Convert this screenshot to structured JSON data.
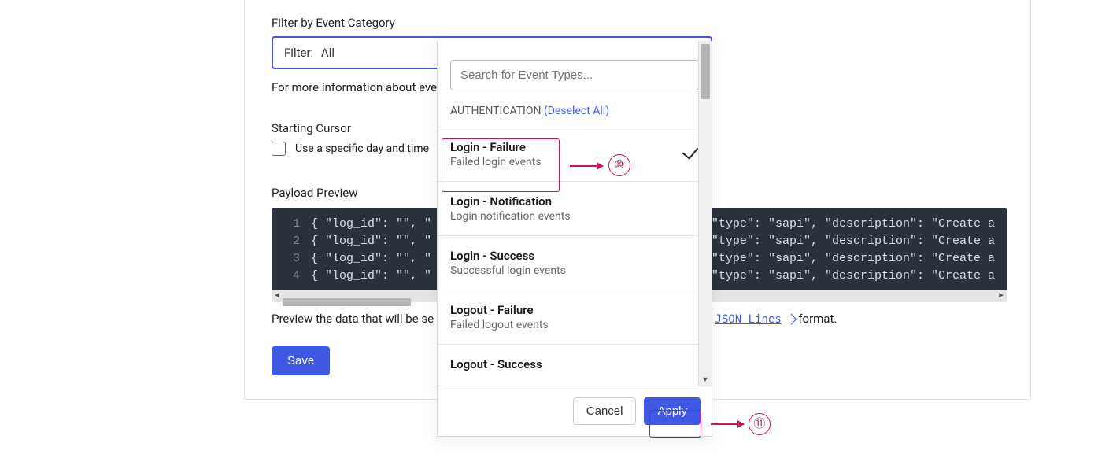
{
  "filter": {
    "label": "Filter by Event Category",
    "prompt": "Filter:",
    "value": "All",
    "hint_before_cut": "For more information about eve"
  },
  "cursor": {
    "label": "Starting Cursor",
    "checkbox_label_before_cut": "Use a specific day and time"
  },
  "payload": {
    "label": "Payload Preview",
    "lines": [
      "{ \"log_id\": \"\", \"",
      "{ \"log_id\": \"\", \"",
      "{ \"log_id\": \"\", \"",
      "{ \"log_id\": \"\", \""
    ],
    "line_tails": [
      "\", \"type\": \"sapi\", \"description\": \"Create a ",
      "\", \"type\": \"sapi\", \"description\": \"Create a ",
      "\", \"type\": \"sapi\", \"description\": \"Create a ",
      "\", \"type\": \"sapi\", \"description\": \"Create a "
    ],
    "desc_before_cut": "Preview the data that will be se",
    "link_text": "JSON Lines",
    "desc_after": "  format."
  },
  "save_label": "Save",
  "dropdown": {
    "search_placeholder": "Search for Event Types...",
    "section": "AUTHENTICATION",
    "deselect": "(Deselect All)",
    "items": [
      {
        "title": "Login - Failure",
        "desc": "Failed login events",
        "selected": true
      },
      {
        "title": "Login - Notification",
        "desc": "Login notification events",
        "selected": false
      },
      {
        "title": "Login - Success",
        "desc": "Successful login events",
        "selected": false
      },
      {
        "title": "Logout - Failure",
        "desc": "Failed logout events",
        "selected": false
      },
      {
        "title": "Logout - Success",
        "desc": "",
        "selected": false
      }
    ],
    "cancel": "Cancel",
    "apply": "Apply"
  },
  "annotations": {
    "n10": "⑩",
    "n11": "⑪"
  }
}
